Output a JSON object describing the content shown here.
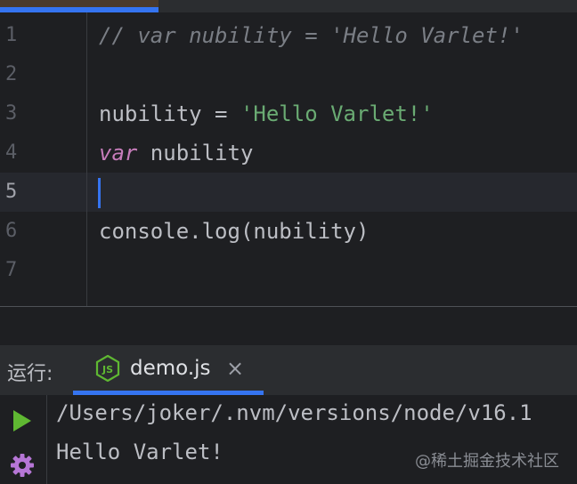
{
  "editor": {
    "lines": [
      {
        "number": "1",
        "comment": "// var nubility = 'Hello Varlet!'"
      },
      {
        "number": "2"
      },
      {
        "number": "3",
        "ident": "nubility",
        "op": " = ",
        "string": "'Hello Varlet!'"
      },
      {
        "number": "4",
        "keyword": "var",
        "ident": " nubility"
      },
      {
        "number": "5"
      },
      {
        "number": "6",
        "text": "console.log(nubility)"
      },
      {
        "number": "7"
      }
    ]
  },
  "run_panel": {
    "label": "运行:",
    "tab_icon": "nodejs-icon",
    "tab_label": "demo.js",
    "close_glyph": "×"
  },
  "console": {
    "command_line": "/Users/joker/.nvm/versions/node/v16.1",
    "output_line": "Hello Varlet!"
  },
  "watermark": "@稀土掘金技术社区",
  "colors": {
    "accent": "#3574f0",
    "string": "#6aab73",
    "keyword": "#c77dbb",
    "run_green": "#5fb832",
    "settings_purple": "#b676d6"
  }
}
